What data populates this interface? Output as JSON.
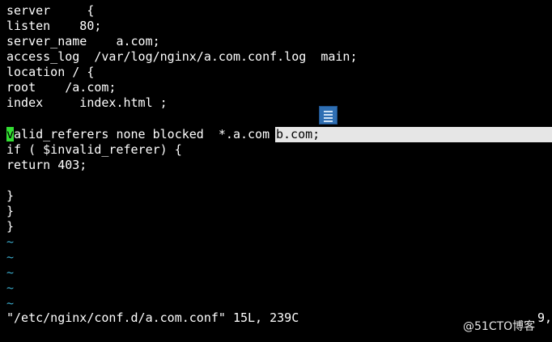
{
  "editor": {
    "lines": {
      "l1": "server     {",
      "l2": "listen    80;",
      "l3": "server_name    a.com;",
      "l4": "access_log  /var/log/nginx/a.com.conf.log  main;",
      "l5": "location / {",
      "l6": "root    /a.com;",
      "l7": "index     index.html ;",
      "l8_cursor_char": "v",
      "l8_rest": "alid_referers none blocked  *.a.com ",
      "l8_selected": "b.com;",
      "l9": "if ( $invalid_referer) {",
      "l10": "return 403;",
      "l12": "}",
      "l13": "}",
      "l14": "}"
    },
    "tilde": "~",
    "status": "\"/etc/nginx/conf.d/a.com.conf\" 15L, 239C",
    "ruler": "9,"
  },
  "overlay": {
    "icon": "document-icon",
    "watermark": "@51CTO博客"
  },
  "colors": {
    "background": "#000000",
    "text": "#ffffff",
    "tilde": "#3aa8c8",
    "cursor": "#33dd33",
    "selection": "#e6e6e6"
  }
}
